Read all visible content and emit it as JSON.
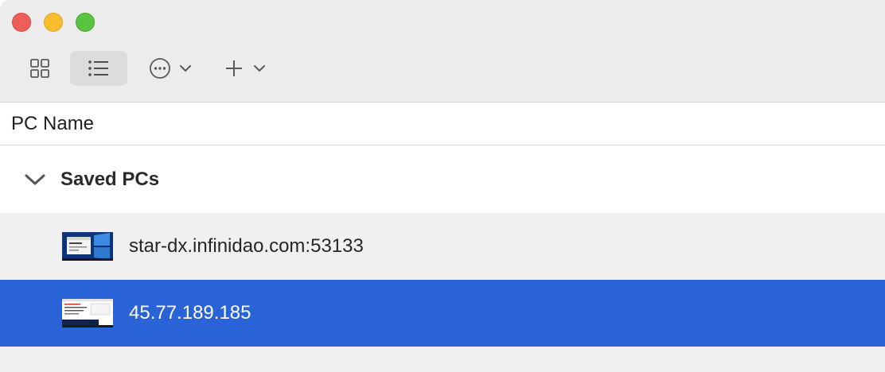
{
  "toolbar": {
    "buttons": [
      {
        "icon": "grid-view-icon"
      },
      {
        "icon": "list-view-icon",
        "selected": true
      },
      {
        "icon": "more-options-icon"
      },
      {
        "icon": "add-icon"
      }
    ]
  },
  "table": {
    "column_header": "PC Name"
  },
  "group": {
    "label": "Saved PCs",
    "expanded": true
  },
  "pcs": [
    {
      "name": "star-dx.infinidao.com:53133",
      "selected": false
    },
    {
      "name": "45.77.189.185",
      "selected": true
    }
  ],
  "colors": {
    "selection": "#2a62d8",
    "close": "#ee5f58",
    "minimize": "#f8bd2f",
    "maximize": "#58c43f"
  }
}
